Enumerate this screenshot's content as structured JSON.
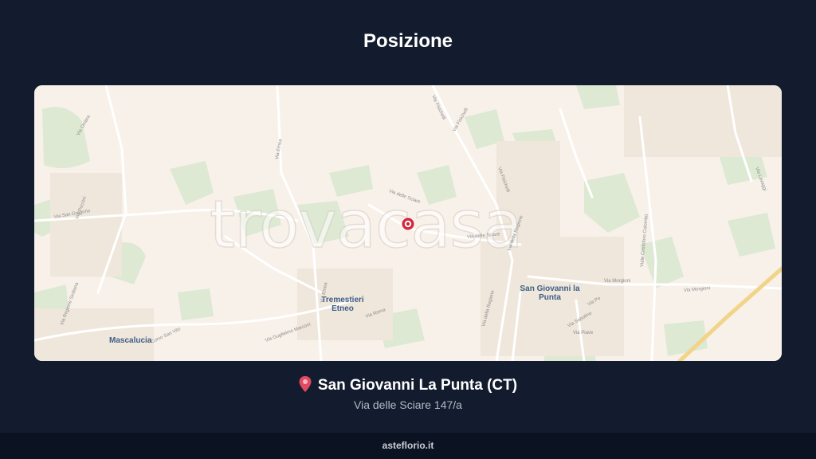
{
  "page": {
    "title": "Posizione",
    "footer": "asteflorio.it"
  },
  "map": {
    "watermark": "trovacasa",
    "places": [
      {
        "name": "Mascalucia"
      },
      {
        "name": "Tremestieri Etneo"
      },
      {
        "name": "San Giovanni la Punta"
      }
    ],
    "streets": [
      "Via Etnea",
      "Via Etnea",
      "Via Fisichelli",
      "Via Fisichelli",
      "Via Fisichelli",
      "Via delle Sciare",
      "Via delle Sciare",
      "Via della Regione",
      "Via della Regione",
      "Via Roma",
      "Via Guglielmo Marconi",
      "Corso San Vito",
      "Via Morgioni",
      "Via Morgioni",
      "Viale Cristoforo Colombo",
      "Via San Gregorio",
      "Via Regione Siciliana",
      "Via Ombra",
      "Via Puccini",
      "Via Po",
      "Via Piave",
      "Via Sabotino",
      "Via Lavaggi"
    ],
    "marker": "location-marker"
  },
  "location": {
    "icon": "map-pin-icon",
    "name": "San Giovanni La Punta (CT)",
    "address": "Via delle Sciare 147/a"
  },
  "colors": {
    "background": "#131c2e",
    "footer": "#0b1222",
    "marker": "#d2263b",
    "map_base": "#f8f1ea",
    "map_green": "#dbe8d2",
    "highway": "#f2d489"
  }
}
